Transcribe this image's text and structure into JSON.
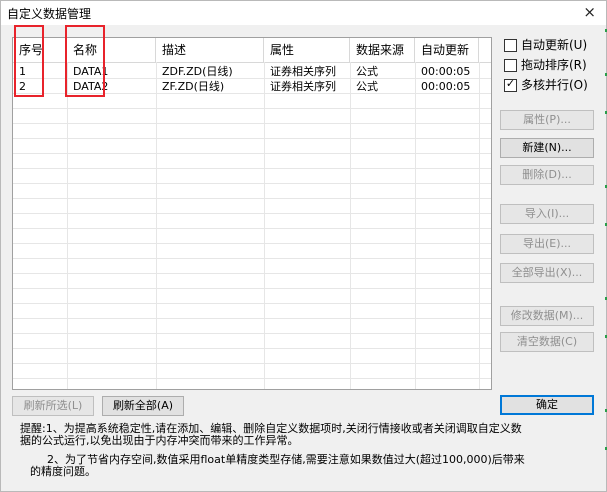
{
  "window": {
    "title": "自定义数据管理",
    "close": "×"
  },
  "table": {
    "columns": [
      "序号",
      "名称",
      "描述",
      "属性",
      "数据来源",
      "自动更新"
    ],
    "rows": [
      [
        "1",
        "DATA1",
        "ZDF.ZD(日线)",
        "证券相关序列",
        "公式",
        "00:00:05"
      ],
      [
        "2",
        "DATA2",
        "ZF.ZD(日线)",
        "证券相关序列",
        "公式",
        "00:00:05"
      ]
    ]
  },
  "options": {
    "auto_update": {
      "label": "自动更新(U)",
      "checked": false
    },
    "drag_sort": {
      "label": "拖动排序(R)",
      "checked": false
    },
    "multi_core": {
      "label": "多核并行(O)",
      "checked": true
    },
    "check_mark": "✓"
  },
  "buttons": {
    "properties": "属性(P)...",
    "new": "新建(N)...",
    "delete": "删除(D)...",
    "import": "导入(I)...",
    "export": "导出(E)...",
    "export_all": "全部导出(X)...",
    "modify": "修改数据(M)...",
    "clear": "清空数据(C)",
    "refresh_selected": "刷新所选(L)",
    "refresh_all": "刷新全部(A)",
    "ok": "确定"
  },
  "tips": {
    "line1": "提醒:1、为提高系统稳定性,请在添加、编辑、删除自定义数据项时,关闭行情接收或者关闭调取自定义数",
    "line2": "据的公式运行,以免出现由于内存冲突而带来的工作异常。",
    "line3": "2、为了节省内存空间,数值采用float单精度类型存储,需要注意如果数值过大(超过100,000)后带来",
    "line4": "的精度问题。"
  },
  "colors": {
    "highlight": "#e8232b",
    "default_button_border": "#0078d7"
  }
}
